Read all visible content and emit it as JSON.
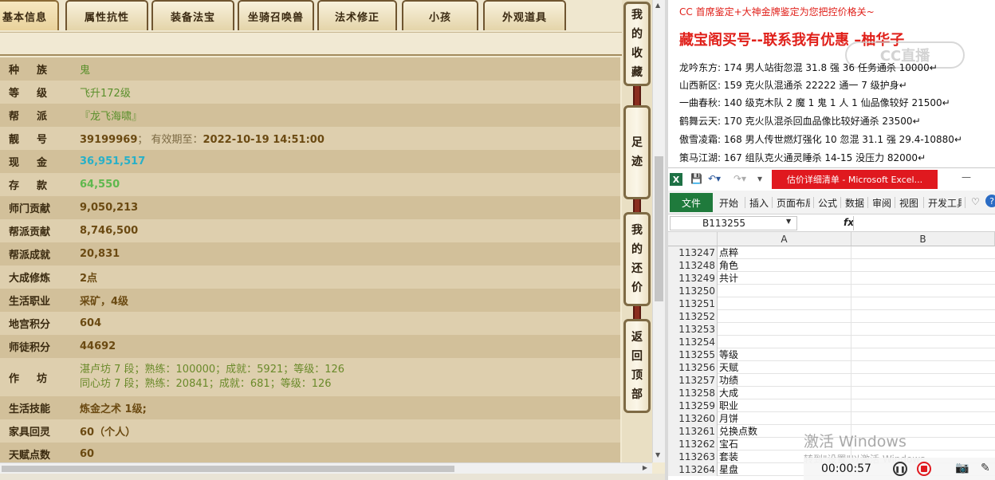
{
  "game": {
    "tabs": [
      "基本信息",
      "属性抗性",
      "装备法宝",
      "坐骑召唤兽",
      "法术修正",
      "小孩",
      "外观道具"
    ],
    "rows": [
      {
        "label": "种族",
        "value": "鬼",
        "style": "green",
        "spaced": true
      },
      {
        "label": "等级",
        "value": "飞升172级",
        "style": "green",
        "spaced": true
      },
      {
        "label": "帮派",
        "value": "『龙飞海啸』",
        "style": "green",
        "spaced": true
      },
      {
        "label": "靓号",
        "value": "39199969",
        "note": "；  有效期至：",
        "extra": "2022-10-19 14:51:00",
        "style": "normal",
        "spaced": true
      },
      {
        "label": "现金",
        "value": "36,951,517",
        "style": "cyan",
        "spaced": true
      },
      {
        "label": "存款",
        "value": "64,550",
        "style": "lgreen",
        "spaced": true
      },
      {
        "label": "师门贡献",
        "value": "9,050,213",
        "style": "normal"
      },
      {
        "label": "帮派贡献",
        "value": "8,746,500",
        "style": "normal"
      },
      {
        "label": "帮派成就",
        "value": "20,831",
        "style": "normal"
      },
      {
        "label": "大成修炼",
        "value": "2点",
        "style": "normal"
      },
      {
        "label": "生活职业",
        "value": "采矿，4级",
        "style": "normal"
      },
      {
        "label": "地宫积分",
        "value": "604",
        "style": "normal"
      },
      {
        "label": "师徒积分",
        "value": "44692",
        "style": "normal"
      },
      {
        "label": "作坊",
        "lines": [
          "湛卢坊 7 段；熟练：100000；成就：5921；等级：126",
          "同心坊 7 段；熟练：20841；成就：681；等级：126"
        ],
        "style": "multi",
        "spaced": true
      },
      {
        "label": "生活技能",
        "value": "炼金之术 1级;",
        "style": "normal"
      },
      {
        "label": "家具回灵",
        "value": "60（个人）",
        "style": "normal"
      },
      {
        "label": "天赋点数",
        "value": "60",
        "style": "normal"
      }
    ],
    "side_buttons": [
      [
        "我",
        "的",
        "收",
        "藏"
      ],
      [
        "足",
        "迹"
      ],
      [
        "我",
        "的",
        "还",
        "价"
      ],
      [
        "返",
        "回",
        "顶",
        "部"
      ]
    ]
  },
  "ad": {
    "line1": "CC 首席鉴定+大神金牌鉴定为您把控价格关~",
    "headline": "藏宝阁买号--联系我有优惠 –柚华子",
    "watermark": "CC直播",
    "listings": [
      "龙吟东方: 174 男人站街忽混 31.8 强 36 任务通杀 10000↵",
      "山西新区: 159 克火队混通杀 22222 通一 7 级护身↵",
      "一曲春秋: 140 级克木队 2 魔 1 鬼 1 人 1 仙品像较好 21500↵",
      "鹤舞云天: 170 克火队混杀回血品像比较好通杀 23500↵",
      "傲雪凌霜: 168 男人传世燃灯强化 10 忽混 31.1 强 29.4-10880↵",
      "策马江湖: 167 组队克火通灵睡杀 14-15 没压力 82000↵"
    ]
  },
  "excel": {
    "logo": "X",
    "title": "估价详细清单 - Microsoft Excel...",
    "ribbon_tabs": [
      "开始",
      "插入",
      "页面布局",
      "公式",
      "数据",
      "审阅",
      "视图",
      "开发工具"
    ],
    "file_tab": "文件",
    "name_box": "B113255",
    "fx": "fx",
    "col_headers": [
      "A",
      "B"
    ],
    "rows": [
      {
        "n": "113247",
        "a": "点粹"
      },
      {
        "n": "113248",
        "a": "角色"
      },
      {
        "n": "113249",
        "a": "共计"
      },
      {
        "n": "113250",
        "a": ""
      },
      {
        "n": "113251",
        "a": ""
      },
      {
        "n": "113252",
        "a": ""
      },
      {
        "n": "113253",
        "a": ""
      },
      {
        "n": "113254",
        "a": ""
      },
      {
        "n": "113255",
        "a": "等级"
      },
      {
        "n": "113256",
        "a": "天赋"
      },
      {
        "n": "113257",
        "a": "功绩"
      },
      {
        "n": "113258",
        "a": "大成"
      },
      {
        "n": "113259",
        "a": "职业"
      },
      {
        "n": "113260",
        "a": "月饼"
      },
      {
        "n": "113261",
        "a": "兑换点数"
      },
      {
        "n": "113262",
        "a": "宝石"
      },
      {
        "n": "113263",
        "a": "套装"
      },
      {
        "n": "113264",
        "a": "星盘"
      }
    ],
    "activate_title": "激活 Windows",
    "activate_sub": "转到\"设置\"以激活 Windows。"
  },
  "recorder": {
    "time": "00:00:57"
  }
}
